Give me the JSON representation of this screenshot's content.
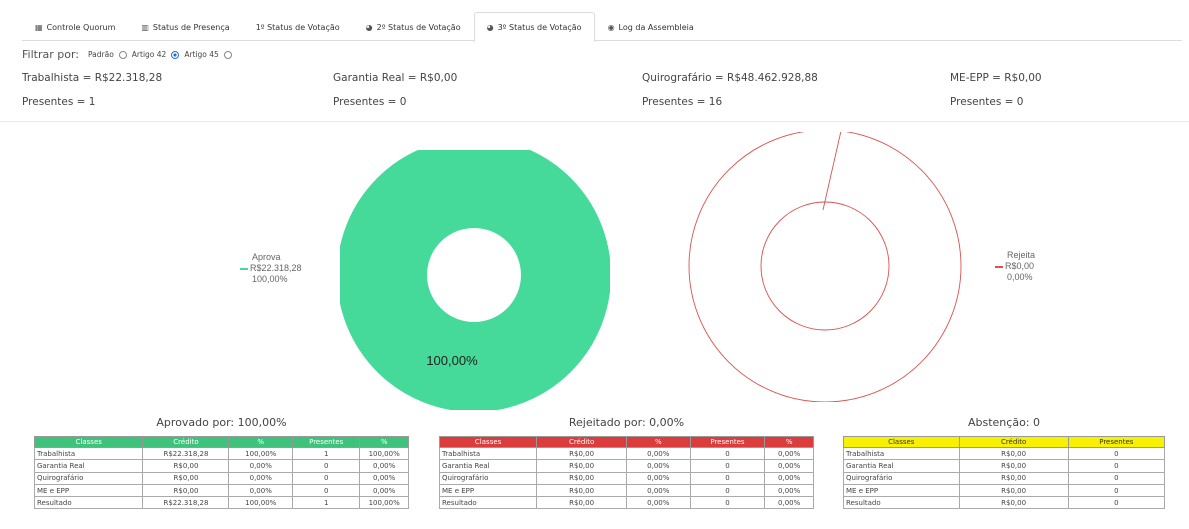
{
  "tabs": [
    {
      "icon": "table-icon",
      "glyph": "▦",
      "label": "Controle Quorum",
      "active": false
    },
    {
      "icon": "bar-chart-icon",
      "glyph": "▥",
      "label": "Status de Presença",
      "active": false
    },
    {
      "icon": "",
      "glyph": "",
      "label": "1º Status de Votação",
      "active": false
    },
    {
      "icon": "pie-chart-icon",
      "glyph": "◕",
      "label": "2º Status de Votação",
      "active": false
    },
    {
      "icon": "pie-chart-icon",
      "glyph": "◕",
      "label": "3º Status de Votação",
      "active": true
    },
    {
      "icon": "eye-icon",
      "glyph": "◉",
      "label": "Log da Assembleia",
      "active": false
    }
  ],
  "filter": {
    "label": "Filtrar por:",
    "options": [
      {
        "label": "Padrão",
        "checked": false
      },
      {
        "label": "Artigo 42",
        "checked": true
      },
      {
        "label": "Artigo 45",
        "checked": false
      }
    ]
  },
  "summary": [
    {
      "credit": "Trabalhista = R$22.318,28",
      "present": "Presentes = 1"
    },
    {
      "credit": "Garantia Real = R$0,00",
      "present": "Presentes = 0"
    },
    {
      "credit": "Quirografário = R$48.462.928,88",
      "present": "Presentes = 16"
    },
    {
      "credit": "ME-EPP = R$0,00",
      "present": "Presentes = 0"
    }
  ],
  "chart_data": [
    {
      "type": "pie",
      "categories": [
        "Aprova"
      ],
      "values": [
        100.0
      ],
      "legend": [
        "Aprova",
        "R$22.318,28",
        "100,00%"
      ],
      "data_label": "100,00%",
      "color": "#45d99a"
    },
    {
      "type": "pie",
      "categories": [
        "Rejeita"
      ],
      "values": [
        0.0
      ],
      "legend": [
        "Rejeita",
        "R$0,00",
        "0,00%"
      ],
      "color": "#d9534f"
    }
  ],
  "approved": {
    "title": "Aprovado por: 100,00%",
    "headers": [
      "Classes",
      "Crédito",
      "%",
      "Presentes",
      "%"
    ],
    "rows": [
      [
        "Trabalhista",
        "R$22.318,28",
        "100,00%",
        "1",
        "100,00%"
      ],
      [
        "Garantia Real",
        "R$0,00",
        "0,00%",
        "0",
        "0,00%"
      ],
      [
        "Quirografário",
        "R$0,00",
        "0,00%",
        "0",
        "0,00%"
      ],
      [
        "ME e EPP",
        "R$0,00",
        "0,00%",
        "0",
        "0,00%"
      ],
      [
        "Resultado",
        "R$22.318,28",
        "100,00%",
        "1",
        "100,00%"
      ]
    ]
  },
  "rejected": {
    "title": "Rejeitado por: 0,00%",
    "headers": [
      "Classes",
      "Crédito",
      "%",
      "Presentes",
      "%"
    ],
    "rows": [
      [
        "Trabalhista",
        "R$0,00",
        "0,00%",
        "0",
        "0,00%"
      ],
      [
        "Garantia Real",
        "R$0,00",
        "0,00%",
        "0",
        "0,00%"
      ],
      [
        "Quirografário",
        "R$0,00",
        "0,00%",
        "0",
        "0,00%"
      ],
      [
        "ME e EPP",
        "R$0,00",
        "0,00%",
        "0",
        "0,00%"
      ],
      [
        "Resultado",
        "R$0,00",
        "0,00%",
        "0",
        "0,00%"
      ]
    ]
  },
  "abstention": {
    "title": "Abstenção: 0",
    "headers": [
      "Classes",
      "Crédito",
      "Presentes"
    ],
    "rows": [
      [
        "Trabalhista",
        "R$0,00",
        "0"
      ],
      [
        "Garantia Real",
        "R$0,00",
        "0"
      ],
      [
        "Quirografário",
        "R$0,00",
        "0"
      ],
      [
        "ME e EPP",
        "R$0,00",
        "0"
      ],
      [
        "Resultado",
        "R$0,00",
        "0"
      ]
    ]
  }
}
